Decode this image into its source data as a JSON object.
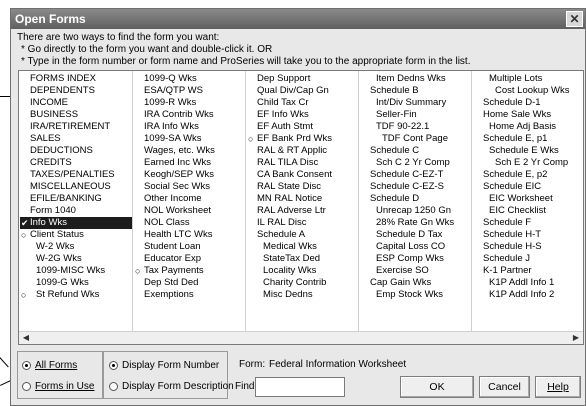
{
  "window": {
    "title": "Open Forms",
    "close_glyph": "✕"
  },
  "instructions": {
    "line1": "There are two ways to find the form you want:",
    "line2": "* Go directly to the form you want and double-click it. OR",
    "line3": "* Type in the form number or form name and ProSeries will take you to the appropriate form in the list."
  },
  "form_list": {
    "columns": [
      {
        "items": [
          {
            "label": "FORMS INDEX"
          },
          {
            "label": "DEPENDENTS"
          },
          {
            "label": "INCOME"
          },
          {
            "label": "BUSINESS"
          },
          {
            "label": "IRA/RETIREMENT"
          },
          {
            "label": "SALES"
          },
          {
            "label": "DEDUCTIONS"
          },
          {
            "label": "CREDITS"
          },
          {
            "label": "TAXES/PENALTIES"
          },
          {
            "label": "MISCELLANEOUS"
          },
          {
            "label": "EFILE/BANKING"
          },
          {
            "label": "Form 1040"
          },
          {
            "label": "Info Wks",
            "mark": "check",
            "selected": true
          },
          {
            "label": "Client Status",
            "mark": "circle"
          },
          {
            "label": "W-2 Wks",
            "indent": 1
          },
          {
            "label": "W-2G Wks",
            "indent": 1
          },
          {
            "label": "1099-MISC Wks",
            "indent": 1
          },
          {
            "label": "1099-G Wks",
            "indent": 1
          },
          {
            "label": "St Refund Wks",
            "mark": "circle",
            "indent": 1
          }
        ]
      },
      {
        "items": [
          {
            "label": "1099-Q Wks"
          },
          {
            "label": "ESA/QTP WS"
          },
          {
            "label": "1099-R Wks"
          },
          {
            "label": "IRA Contrib Wks"
          },
          {
            "label": "IRA Info Wks"
          },
          {
            "label": "1099-SA Wks"
          },
          {
            "label": "Wages, etc. Wks"
          },
          {
            "label": "Earned Inc Wks"
          },
          {
            "label": "Keogh/SEP Wks"
          },
          {
            "label": "Social Sec Wks"
          },
          {
            "label": "Other Income"
          },
          {
            "label": "NOL Worksheet"
          },
          {
            "label": "NOL Class"
          },
          {
            "label": "Health LTC Wks"
          },
          {
            "label": "Student Loan"
          },
          {
            "label": "Educator Exp"
          },
          {
            "label": "Tax Payments",
            "mark": "circle"
          },
          {
            "label": "Dep Std Ded"
          },
          {
            "label": "Exemptions"
          }
        ]
      },
      {
        "items": [
          {
            "label": "Dep Support"
          },
          {
            "label": "Qual Div/Cap Gn"
          },
          {
            "label": "Child Tax Cr"
          },
          {
            "label": "EF Info Wks"
          },
          {
            "label": "EF Auth Stmt"
          },
          {
            "label": "EF Bank Prd Wks",
            "mark": "circle"
          },
          {
            "label": "RAL & RT Applic"
          },
          {
            "label": "RAL TILA Disc"
          },
          {
            "label": "CA Bank Consent"
          },
          {
            "label": "RAL State Disc"
          },
          {
            "label": "MN RAL Notice"
          },
          {
            "label": "RAL Adverse Ltr"
          },
          {
            "label": "IL RAL Disc"
          },
          {
            "label": "Schedule A"
          },
          {
            "label": "Medical Wks",
            "indent": 1
          },
          {
            "label": "StateTax Ded",
            "indent": 1
          },
          {
            "label": "Locality Wks",
            "indent": 1
          },
          {
            "label": "Charity Contrib",
            "indent": 1
          },
          {
            "label": "Misc Dedns",
            "indent": 1
          }
        ]
      },
      {
        "items": [
          {
            "label": "Item Dedns Wks",
            "indent": 1
          },
          {
            "label": "Schedule B"
          },
          {
            "label": "Int/Div Summary",
            "indent": 1
          },
          {
            "label": "Seller-Fin",
            "indent": 1
          },
          {
            "label": "TDF 90-22.1",
            "indent": 1
          },
          {
            "label": "TDF Cont Page",
            "indent": 2
          },
          {
            "label": "Schedule C"
          },
          {
            "label": "Sch C 2 Yr Comp",
            "indent": 1
          },
          {
            "label": "Schedule C-EZ-T"
          },
          {
            "label": "Schedule C-EZ-S"
          },
          {
            "label": "Schedule D"
          },
          {
            "label": "Unrecap 1250 Gn",
            "indent": 1
          },
          {
            "label": "28% Rate Gn Wks",
            "indent": 1
          },
          {
            "label": "Schedule D Tax",
            "indent": 1
          },
          {
            "label": "Capital Loss CO",
            "indent": 1
          },
          {
            "label": "ESP Comp Wks",
            "indent": 1
          },
          {
            "label": "Exercise SO",
            "indent": 1
          },
          {
            "label": "Cap Gain Wks"
          },
          {
            "label": "Emp Stock Wks",
            "indent": 1
          }
        ]
      },
      {
        "items": [
          {
            "label": "Multiple Lots",
            "indent": 1
          },
          {
            "label": "Cost Lookup Wks",
            "indent": 2
          },
          {
            "label": "Schedule D-1"
          },
          {
            "label": "Home Sale Wks"
          },
          {
            "label": "Home Adj Basis",
            "indent": 1
          },
          {
            "label": "Schedule E, p1"
          },
          {
            "label": "Schedule E Wks",
            "indent": 1
          },
          {
            "label": "Sch E 2 Yr Comp",
            "indent": 2
          },
          {
            "label": "Schedule E, p2"
          },
          {
            "label": "Schedule EIC"
          },
          {
            "label": "EIC Worksheet",
            "indent": 1
          },
          {
            "label": "EIC Checklist",
            "indent": 1
          },
          {
            "label": "Schedule F"
          },
          {
            "label": "Schedule H-T"
          },
          {
            "label": "Schedule H-S"
          },
          {
            "label": "Schedule J"
          },
          {
            "label": "K-1 Partner"
          },
          {
            "label": "K1P Addl Info 1",
            "indent": 1
          },
          {
            "label": "K1P Addl Info 2",
            "indent": 1
          }
        ]
      }
    ]
  },
  "filter": {
    "all_forms": "All Forms",
    "forms_in_use": "Forms in Use",
    "selected": "all_forms"
  },
  "display": {
    "number": "Display Form Number",
    "description": "Display Form Description",
    "selected": "number"
  },
  "form_field": {
    "label": "Form:",
    "value": "Federal Information Worksheet"
  },
  "find": {
    "label": "Find:",
    "value": ""
  },
  "buttons": {
    "ok": "OK",
    "cancel": "Cancel",
    "help": "Help"
  },
  "scroll": {
    "left_arrow": "◀",
    "right_arrow": "▶"
  }
}
